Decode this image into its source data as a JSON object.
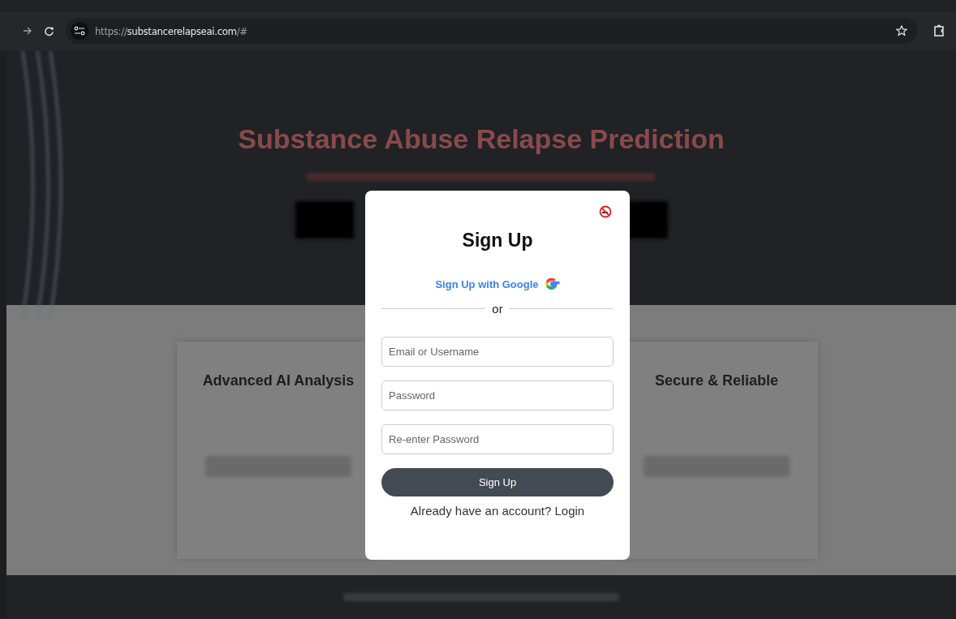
{
  "browser": {
    "url_scheme": "https://",
    "url_host": "substancerelapseai.com",
    "url_rest": "/#"
  },
  "hero": {
    "title": "Substance Abuse Relapse Prediction"
  },
  "features": [
    {
      "title": "Advanced AI Analysis"
    },
    {
      "title": "Secure & Reliable"
    }
  ],
  "modal": {
    "title": "Sign Up",
    "google_label": "Sign Up with Google",
    "divider": "or",
    "fields": [
      {
        "placeholder": "Email or Username"
      },
      {
        "placeholder": "Password"
      },
      {
        "placeholder": "Re-enter Password"
      }
    ],
    "submit": "Sign Up",
    "login_prompt": "Already have an account? Login"
  }
}
